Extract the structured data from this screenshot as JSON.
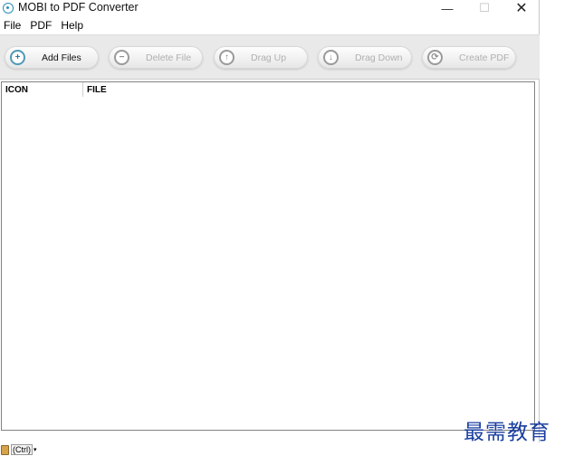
{
  "window": {
    "title": "MOBI to PDF Converter",
    "minimize_glyph": "—",
    "maximize_glyph": "☐",
    "close_glyph": "✕"
  },
  "menu": {
    "items": [
      {
        "label": "File"
      },
      {
        "label": "PDF"
      },
      {
        "label": "Help"
      }
    ]
  },
  "toolbar": {
    "buttons": [
      {
        "label": "Add Files",
        "icon": "plus-icon",
        "glyph": "+",
        "enabled": true
      },
      {
        "label": "Delete File",
        "icon": "minus-icon",
        "glyph": "−",
        "enabled": false
      },
      {
        "label": "Drag Up",
        "icon": "arrow-up-icon",
        "glyph": "↑",
        "enabled": false
      },
      {
        "label": "Drag Down",
        "icon": "arrow-down-icon",
        "glyph": "↓",
        "enabled": false
      },
      {
        "label": "Create PDF",
        "icon": "refresh-icon",
        "glyph": "⟳",
        "enabled": false
      }
    ]
  },
  "file_list": {
    "columns": [
      "ICON",
      "FILE"
    ],
    "rows": []
  },
  "taskbar": {
    "ctrl_label": "(Ctrl)"
  },
  "watermark": {
    "text": "最需教育"
  }
}
